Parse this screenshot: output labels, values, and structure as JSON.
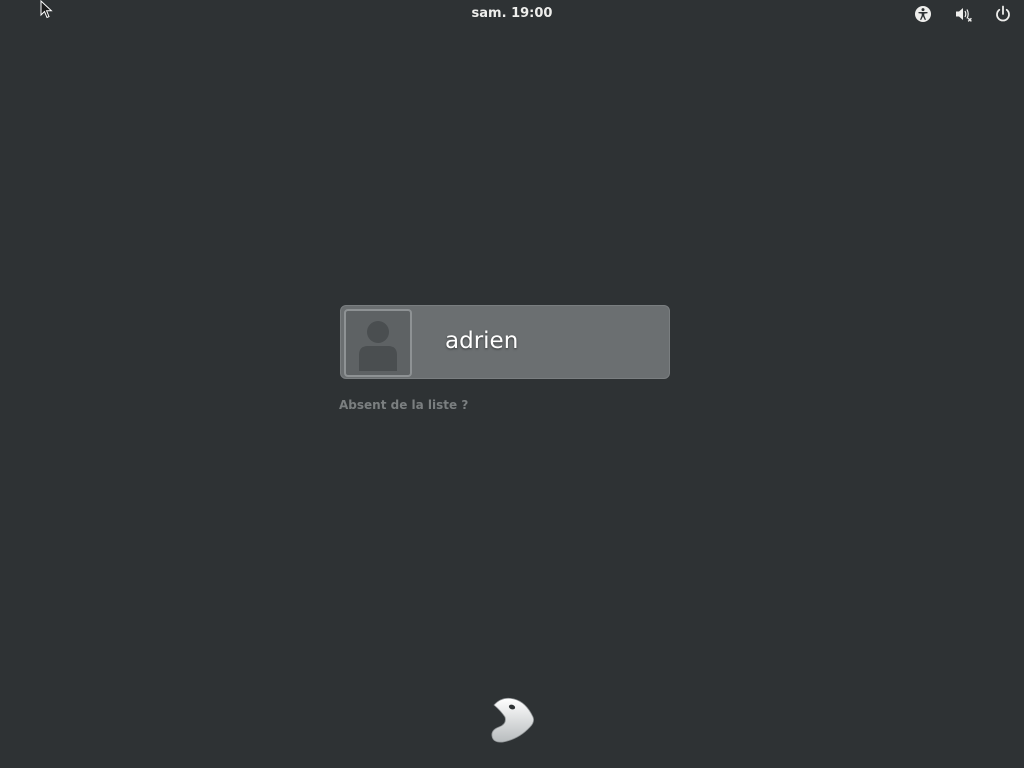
{
  "top_bar": {
    "clock": "sam. 19:00",
    "icons": {
      "accessibility": "accessibility-icon",
      "volume": "volume-muted-icon",
      "power": "power-icon"
    }
  },
  "user_list": {
    "users": [
      {
        "name": "adrien",
        "avatar_icon": "default-avatar-icon"
      }
    ],
    "not_listed_label": "Absent de la liste ?"
  },
  "branding": {
    "logo_icon": "gnome-foot-logo"
  },
  "colors": {
    "background": "#2e3234",
    "user_card": "#6b6f71",
    "text": "#eeeeec",
    "muted_text": "#7b7f80"
  }
}
